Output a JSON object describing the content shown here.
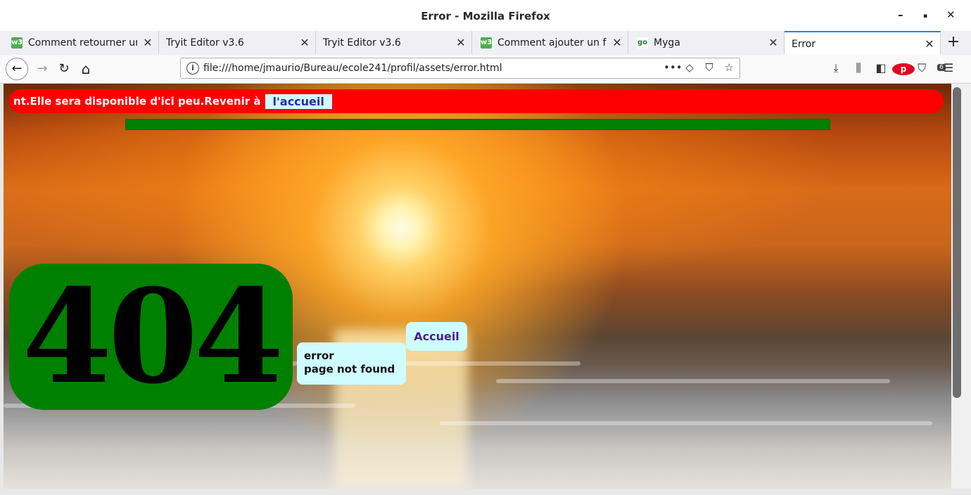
{
  "window": {
    "title": "Error - Mozilla Firefox",
    "minimize": "–",
    "maximize": "▪",
    "close": "✕"
  },
  "tabs": [
    {
      "label": "Comment retourner une",
      "favicon": "w3",
      "favicon_color": "#4caf50",
      "close": "✕"
    },
    {
      "label": "Tryit Editor v3.6",
      "favicon": "",
      "close": "✕"
    },
    {
      "label": "Tryit Editor v3.6",
      "favicon": "",
      "close": "✕"
    },
    {
      "label": "Comment ajouter un for",
      "favicon": "w3",
      "favicon_color": "#4caf50",
      "close": "✕"
    },
    {
      "label": "Myga",
      "favicon": "go",
      "favicon_color": "#2e7d32",
      "close": "✕"
    },
    {
      "label": "Error",
      "favicon": "",
      "close": "✕",
      "active": true
    }
  ],
  "new_tab": "+",
  "nav": {
    "back": "←",
    "forward": "→",
    "reload": "↻",
    "home": "⌂",
    "url": "file:///home/jmaurio/Bureau/ecole241/profil/assets/error.html",
    "page_actions": "•••",
    "pocket": "◇",
    "pocket2": "⛉",
    "bookmark": "☆",
    "downloads": "⤓",
    "library": "⫼",
    "sidebar": "◧",
    "pinterest": "p",
    "extensions_badge": "6",
    "menu": "☰"
  },
  "page": {
    "marquee_text": "nt.Elle sera disponible d'ici peu.Revenir à",
    "home_link": "l'accueil",
    "error_code": "404",
    "error_line1": "error",
    "error_line2": "page not found",
    "accueil_button": "Accueil"
  },
  "colors": {
    "red_banner": "#ff0000",
    "green": "#008000",
    "light_cyan": "#cffcff",
    "link_text": "#2c2aa8",
    "accueil_text": "#4b1d8f"
  }
}
